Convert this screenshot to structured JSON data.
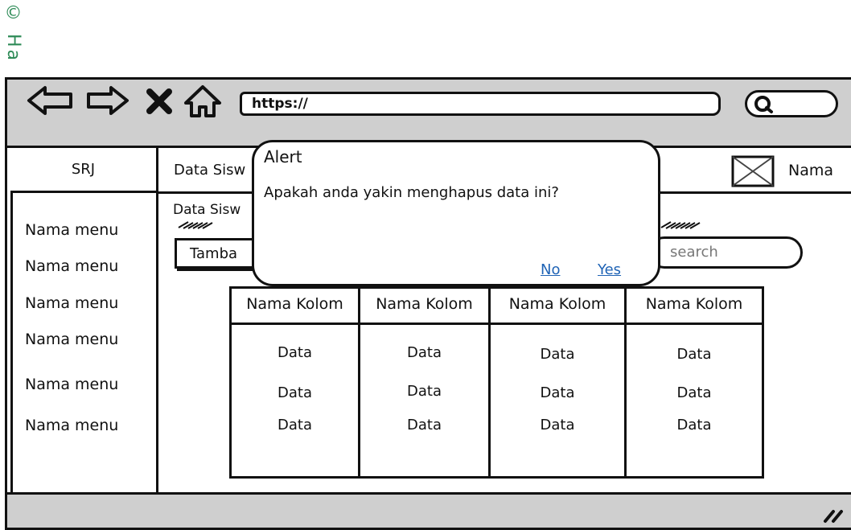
{
  "watermark": "© Ha",
  "browser": {
    "url": "https://",
    "icons": [
      "back-arrow-icon",
      "forward-arrow-icon",
      "close-x-icon",
      "home-icon",
      "search-icon"
    ]
  },
  "brand": "SRJ",
  "header": {
    "tab_label": "Data Sisw",
    "user_name": "Nama"
  },
  "sidebar": {
    "items": [
      "Nama menu",
      "Nama menu",
      "Nama menu",
      "Nama menu",
      "Nama menu",
      "Nama menu"
    ]
  },
  "main": {
    "page_title": "Data Sisw",
    "add_button": "Tamba",
    "search_placeholder": "search"
  },
  "table": {
    "headers": [
      "Nama Kolom",
      "Nama Kolom",
      "Nama Kolom",
      "Nama Kolom"
    ],
    "rows": [
      [
        "Data",
        "Data",
        "Data",
        "Data"
      ],
      [
        "Data",
        "Data",
        "Data",
        "Data"
      ],
      [
        "Data",
        "Data",
        "Data",
        "Data"
      ]
    ]
  },
  "alert": {
    "title": "Alert",
    "message": "Apakah anda yakin menghapus data ini?",
    "no_label": "No",
    "yes_label": "Yes"
  },
  "colors": {
    "link": "#1f63b5",
    "chrome": "#cfcfcf",
    "watermark": "#2e8b57"
  }
}
